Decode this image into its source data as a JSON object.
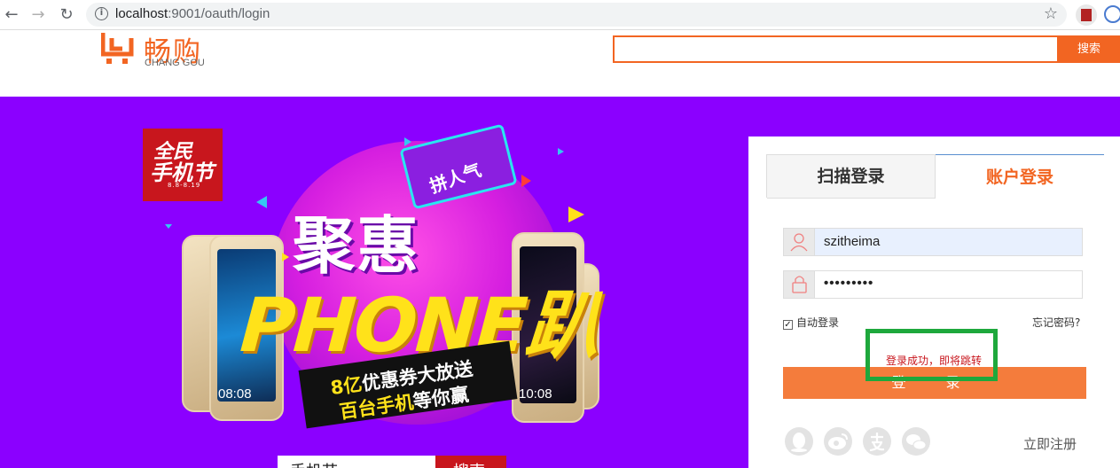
{
  "browser": {
    "url_host": "localhost",
    "url_rest": ":9001/oauth/login",
    "back_icon": "arrow-back-icon",
    "forward_icon": "arrow-forward-icon",
    "reload_icon": "reload-icon",
    "bookmark_icon": "star-icon"
  },
  "header": {
    "logo_cn": "畅购",
    "logo_en": "CHANG GOU",
    "search_button": "搜索",
    "search_value": ""
  },
  "banner": {
    "badge_line1": "全民",
    "badge_line2": "手机节",
    "badge_line3": "8.8-8.19",
    "ribbon": "拼人气",
    "headline_cn": "聚惠",
    "headline_en": "PHONE趴",
    "promo_yellow1": "8亿",
    "promo_white1": "优惠券大放送",
    "promo_yellow2": "百台手机",
    "promo_white2": "等你赢",
    "phone_left_time": "08:08",
    "phone_right_time": "10:08",
    "bottom_search_text": "手机节",
    "bottom_search_button": "搜索"
  },
  "login": {
    "tab_scan": "扫描登录",
    "tab_account": "账户登录",
    "username": "szitheima",
    "password_masked": "•••••••••",
    "remember_label": "自动登录",
    "remember_checked": true,
    "forgot_label": "忘记密码?",
    "login_button": "登 录",
    "success_message": "登录成功，即将跳转",
    "register_label": "立即注册",
    "social_icons": [
      "qq-icon",
      "weibo-icon",
      "alipay-icon",
      "wechat-icon"
    ]
  },
  "colors": {
    "brand_orange": "#f26522",
    "banner_purple": "#8b00ff",
    "highlight_green": "#1ea83c",
    "error_red": "#c8161d"
  }
}
